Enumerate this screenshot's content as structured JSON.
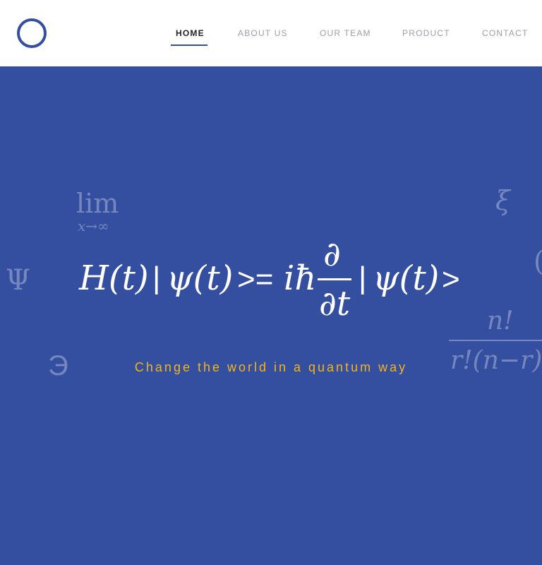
{
  "header": {
    "nav": [
      {
        "label": "HOME",
        "active": true
      },
      {
        "label": "ABOUT US",
        "active": false
      },
      {
        "label": "OUR TEAM",
        "active": false
      },
      {
        "label": "PRODUCT",
        "active": false
      },
      {
        "label": "CONTACT",
        "active": false
      }
    ]
  },
  "hero": {
    "equation": {
      "lhs": "H(t)",
      "bar1": "|",
      "psi1": "ψ(t)",
      "gteq": ">=",
      "ihbar": "iħ",
      "partial": "∂",
      "dt": "∂t",
      "bar2": "|",
      "psi2": "ψ(t)",
      "gt": ">"
    },
    "tagline": "Change the world in a quantum way",
    "background_symbols": {
      "lim": "lim",
      "lim_sub": "x→∞",
      "xi": "ξ",
      "psi": "Ψ",
      "epsilon": "Э",
      "n_fact": "n!",
      "r_fact": "r!(n−r)"
    }
  },
  "colors": {
    "brand_blue": "#344ea0",
    "accent_yellow": "#f2b51f",
    "nav_active": "#222222",
    "nav_inactive": "#9aa0a8"
  }
}
